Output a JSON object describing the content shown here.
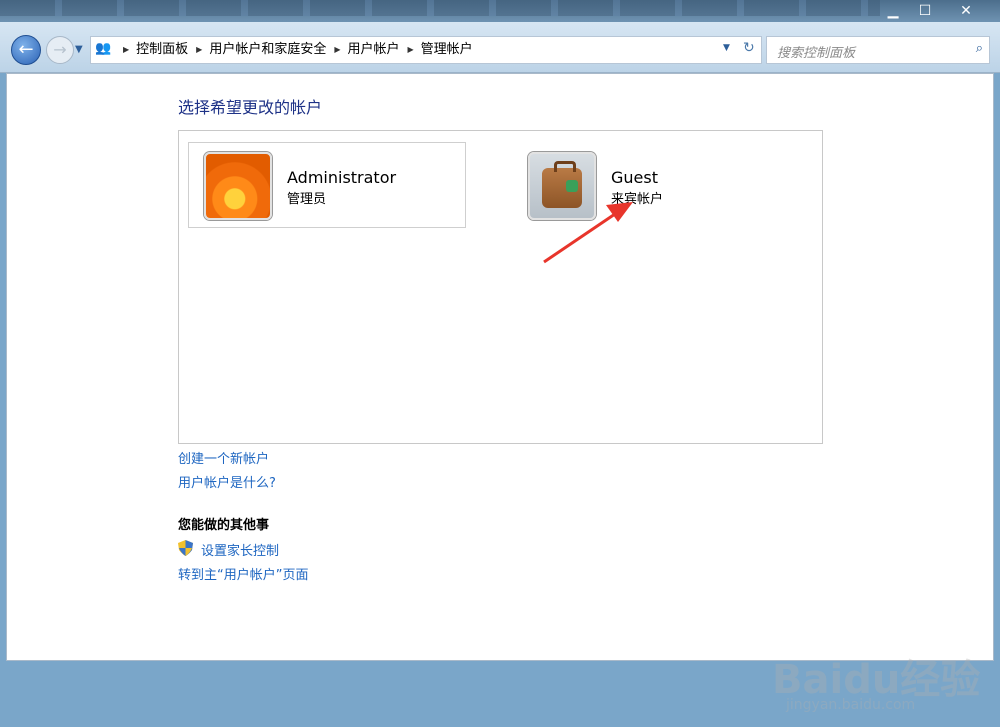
{
  "window": {
    "controls": {
      "minimize": "▁",
      "maximize": "☐",
      "close": "✕"
    }
  },
  "nav": {
    "back_icon": "←",
    "forward_icon": "→",
    "history_icon": "▼",
    "breadcrumbs": [
      "控制面板",
      "用户帐户和家庭安全",
      "用户帐户",
      "管理帐户"
    ],
    "address_dropdown_icon": "▼",
    "refresh_icon": "↻",
    "search_placeholder": "搜索控制面板",
    "search_icon": "⌕"
  },
  "main": {
    "heading": "选择希望更改的帐户",
    "accounts": [
      {
        "name": "Administrator",
        "type": "管理员",
        "picture": "orange-flower"
      },
      {
        "name": "Guest",
        "type": "来宾帐户",
        "picture": "suitcase"
      }
    ],
    "links": {
      "create": "创建一个新帐户",
      "what_is": "用户帐户是什么?"
    },
    "other_tasks_heading": "您能做的其他事",
    "other_tasks": {
      "parental": "设置家长控制",
      "main_page": "转到主“用户帐户”页面"
    }
  },
  "watermark": {
    "logo": "Baidu经验",
    "url": "jingyan.baidu.com"
  },
  "colors": {
    "link": "#1e66c1",
    "heading": "#1e3287",
    "annotation_arrow": "#e8352b"
  }
}
